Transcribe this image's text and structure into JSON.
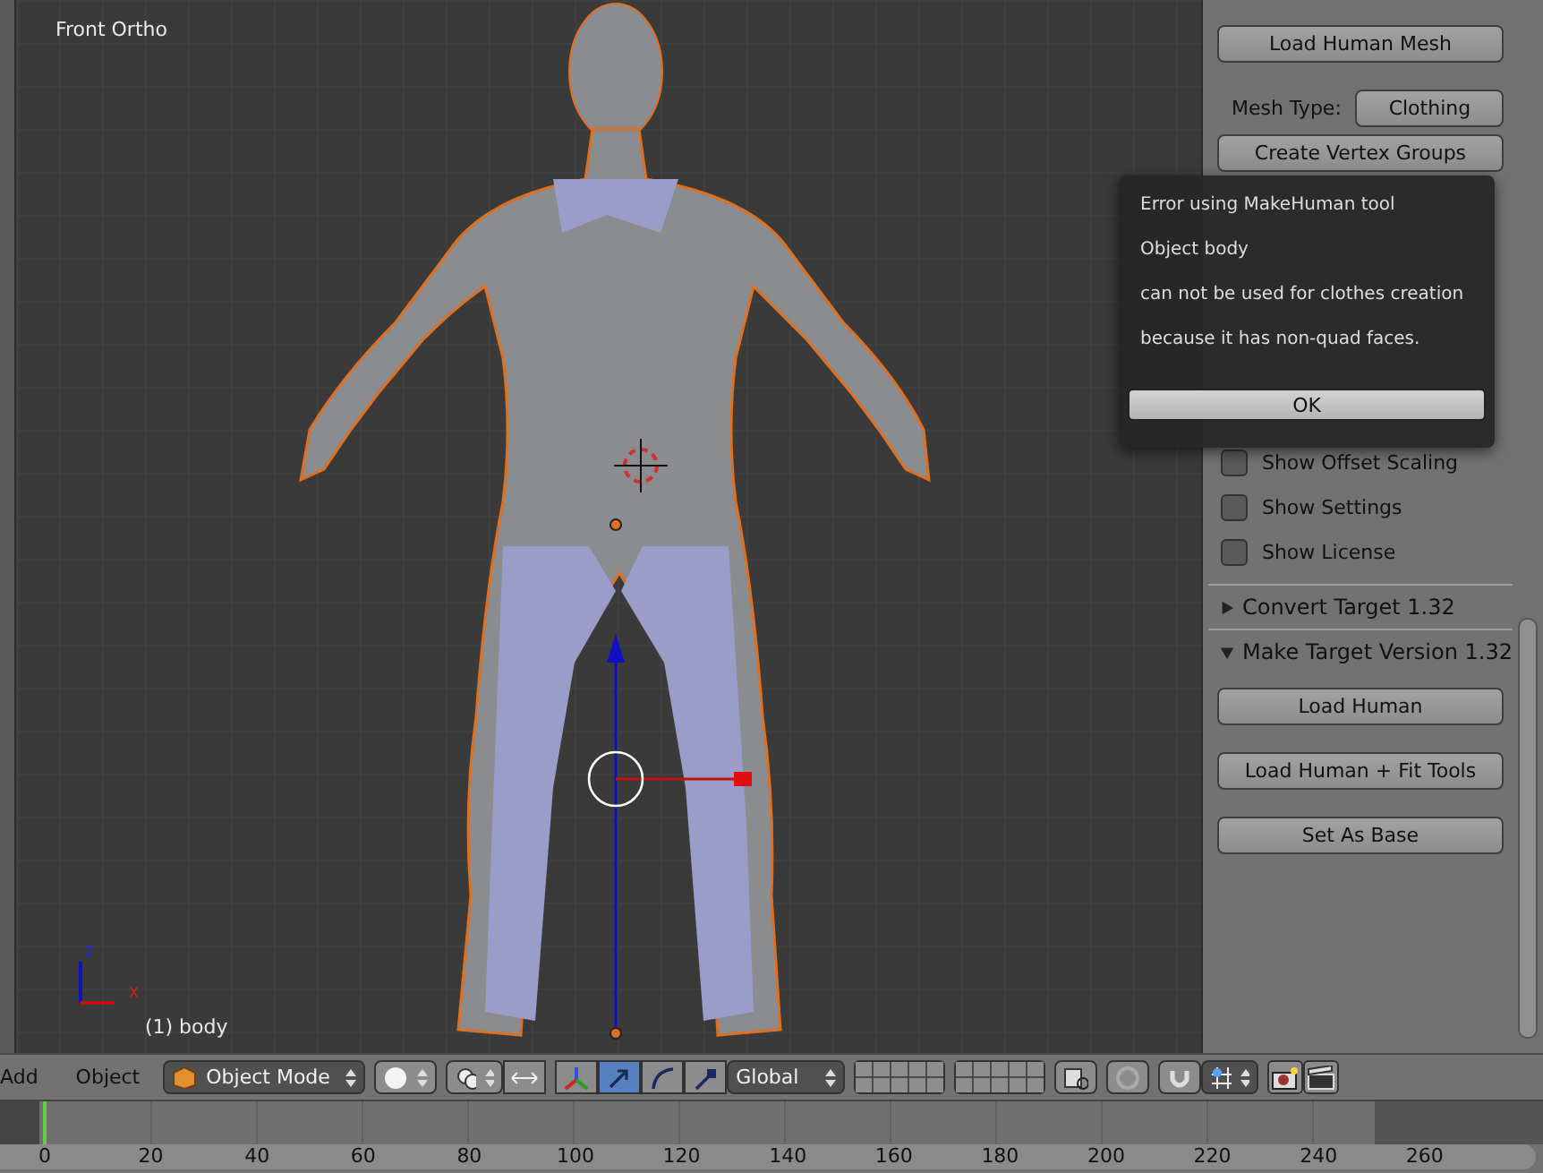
{
  "viewport": {
    "view_name": "Front Ortho",
    "object_name": "(1) body",
    "axis_labels": [
      "Z",
      "X"
    ]
  },
  "panel": {
    "items": [
      {
        "kind": "button",
        "label": "Load Human Mesh"
      },
      {
        "kind": "field",
        "label": "Mesh Type:",
        "value": "Clothing"
      },
      {
        "kind": "button",
        "label": "Create Vertex Groups"
      },
      {
        "kind": "checkbox",
        "label": "Show Offset Scaling",
        "checked": false
      },
      {
        "kind": "checkbox",
        "label": "Show Settings",
        "checked": false
      },
      {
        "kind": "checkbox",
        "label": "Show License",
        "checked": false
      },
      {
        "kind": "section",
        "label": "Convert Target 1.32",
        "expanded": false
      },
      {
        "kind": "section",
        "label": "Make Target  Version 1.32",
        "expanded": true
      },
      {
        "kind": "button",
        "label": "Load Human"
      },
      {
        "kind": "button",
        "label": "Load Human + Fit Tools"
      },
      {
        "kind": "button",
        "label": "Set As Base"
      }
    ]
  },
  "dialog": {
    "lines": [
      "Error using MakeHuman tool",
      "Object body",
      "can not be used for clothes creation",
      "because it has non-quad faces."
    ],
    "button": "OK"
  },
  "header": {
    "menus": [
      "Add",
      "Object"
    ],
    "mode": "Object Mode",
    "orientation": "Global",
    "manipulators": [
      {
        "kind": "axes",
        "selected": false
      },
      {
        "kind": "translate",
        "selected": true
      },
      {
        "kind": "rotate",
        "selected": false
      },
      {
        "kind": "scale",
        "selected": false
      }
    ]
  },
  "timeline": {
    "ticks": [
      "0",
      "20",
      "40",
      "60",
      "80",
      "100",
      "120",
      "140",
      "160",
      "180",
      "200",
      "220",
      "240",
      "260"
    ]
  }
}
